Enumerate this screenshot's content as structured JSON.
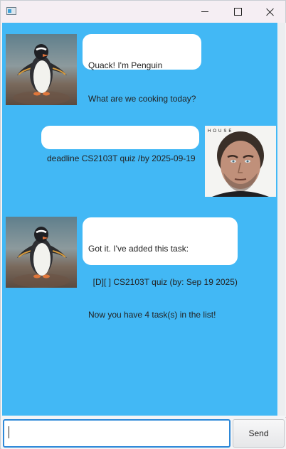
{
  "window": {
    "icon": "app-window-icon",
    "controls": [
      "minimize-icon",
      "maximize-icon",
      "close-icon"
    ]
  },
  "dialog": {
    "background": "#42b8f5",
    "messages": [
      {
        "sender": "bot",
        "avatar": "penguin-avatar",
        "lines": [
          "Quack! I'm Penguin",
          "What are we cooking today?"
        ]
      },
      {
        "sender": "user",
        "avatar": "user-avatar",
        "avatar_caption": "HOUSE",
        "lines": [
          "deadline CS2103T quiz /by 2025-09-19"
        ]
      },
      {
        "sender": "bot",
        "avatar": "penguin-avatar",
        "lines": [
          "Got it. I've added this task:",
          "  [D][ ] CS2103T quiz (by: Sep 19 2025)",
          "Now you have 4 task(s) in the list!"
        ]
      }
    ]
  },
  "input": {
    "value": "",
    "placeholder": ""
  },
  "send_label": "Send"
}
